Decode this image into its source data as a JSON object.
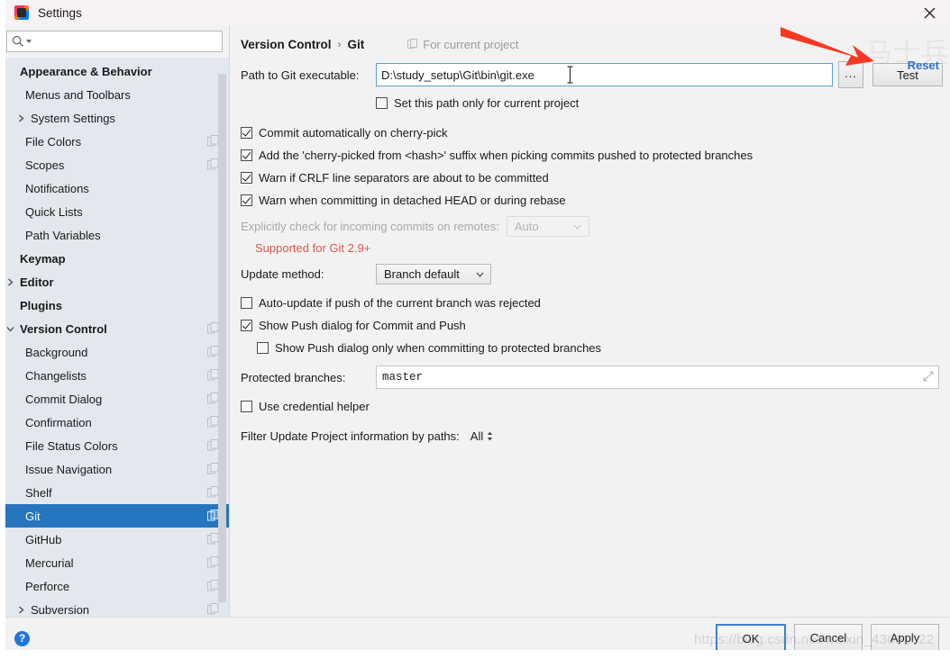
{
  "window": {
    "title": "Settings",
    "app_icon": "intellij-idea-icon",
    "close_label": "×"
  },
  "search": {
    "value": "",
    "placeholder": "",
    "icon": "search-icon"
  },
  "sidebar": {
    "items": [
      {
        "label": "Appearance & Behavior",
        "level": 0,
        "bold": true,
        "arrow": "none",
        "badge": false,
        "selected": false
      },
      {
        "label": "Menus and Toolbars",
        "level": 1,
        "bold": false,
        "arrow": "none",
        "badge": false,
        "selected": false
      },
      {
        "label": "System Settings",
        "level": 1,
        "bold": false,
        "arrow": "right",
        "badge": false,
        "selected": false
      },
      {
        "label": "File Colors",
        "level": 1,
        "bold": false,
        "arrow": "none",
        "badge": true,
        "selected": false
      },
      {
        "label": "Scopes",
        "level": 1,
        "bold": false,
        "arrow": "none",
        "badge": true,
        "selected": false
      },
      {
        "label": "Notifications",
        "level": 1,
        "bold": false,
        "arrow": "none",
        "badge": false,
        "selected": false
      },
      {
        "label": "Quick Lists",
        "level": 1,
        "bold": false,
        "arrow": "none",
        "badge": false,
        "selected": false
      },
      {
        "label": "Path Variables",
        "level": 1,
        "bold": false,
        "arrow": "none",
        "badge": false,
        "selected": false
      },
      {
        "label": "Keymap",
        "level": 0,
        "bold": true,
        "arrow": "none",
        "badge": false,
        "selected": false
      },
      {
        "label": "Editor",
        "level": 0,
        "bold": true,
        "arrow": "right",
        "badge": false,
        "selected": false
      },
      {
        "label": "Plugins",
        "level": 0,
        "bold": true,
        "arrow": "none",
        "badge": false,
        "selected": false
      },
      {
        "label": "Version Control",
        "level": 0,
        "bold": true,
        "arrow": "down",
        "badge": true,
        "selected": false
      },
      {
        "label": "Background",
        "level": 1,
        "bold": false,
        "arrow": "none",
        "badge": true,
        "selected": false
      },
      {
        "label": "Changelists",
        "level": 1,
        "bold": false,
        "arrow": "none",
        "badge": true,
        "selected": false
      },
      {
        "label": "Commit Dialog",
        "level": 1,
        "bold": false,
        "arrow": "none",
        "badge": true,
        "selected": false
      },
      {
        "label": "Confirmation",
        "level": 1,
        "bold": false,
        "arrow": "none",
        "badge": true,
        "selected": false
      },
      {
        "label": "File Status Colors",
        "level": 1,
        "bold": false,
        "arrow": "none",
        "badge": true,
        "selected": false
      },
      {
        "label": "Issue Navigation",
        "level": 1,
        "bold": false,
        "arrow": "none",
        "badge": true,
        "selected": false
      },
      {
        "label": "Shelf",
        "level": 1,
        "bold": false,
        "arrow": "none",
        "badge": true,
        "selected": false
      },
      {
        "label": "Git",
        "level": 1,
        "bold": false,
        "arrow": "none",
        "badge": true,
        "selected": true
      },
      {
        "label": "GitHub",
        "level": 1,
        "bold": false,
        "arrow": "none",
        "badge": true,
        "selected": false
      },
      {
        "label": "Mercurial",
        "level": 1,
        "bold": false,
        "arrow": "none",
        "badge": true,
        "selected": false
      },
      {
        "label": "Perforce",
        "level": 1,
        "bold": false,
        "arrow": "none",
        "badge": true,
        "selected": false
      },
      {
        "label": "Subversion",
        "level": 1,
        "bold": false,
        "arrow": "right",
        "badge": true,
        "selected": false
      }
    ]
  },
  "main": {
    "breadcrumb": {
      "parent": "Version Control",
      "separator": "›",
      "current": "Git"
    },
    "for_current_project": "For current project",
    "reset_link": "Reset",
    "path_label": "Path to Git executable:",
    "path_value": "D:\\study_setup\\Git\\bin\\git.exe",
    "browse_label": "...",
    "test_label": "Test",
    "set_path_only_label": "Set this path only for current project",
    "set_path_only_checked": false,
    "checkboxes": [
      {
        "label": "Commit automatically on cherry-pick",
        "checked": true
      },
      {
        "label": "Add the 'cherry-picked from <hash>' suffix when picking commits pushed to protected branches",
        "checked": true
      },
      {
        "label": "Warn if CRLF line separators are about to be committed",
        "checked": true
      },
      {
        "label": "Warn when committing in detached HEAD or during rebase",
        "checked": true
      }
    ],
    "explicit_check_label": "Explicitly check for incoming commits on remotes:",
    "explicit_check_value": "Auto",
    "explicit_check_disabled": true,
    "supported_note": "Supported for Git 2.9+",
    "update_method_label": "Update method:",
    "update_method_value": "Branch default",
    "auto_update_label": "Auto-update if push of the current branch was rejected",
    "auto_update_checked": false,
    "show_push_label": "Show Push dialog for Commit and Push",
    "show_push_checked": true,
    "show_push_protected_label": "Show Push dialog only when committing to protected branches",
    "show_push_protected_checked": false,
    "protected_branches_label": "Protected branches:",
    "protected_branches_value": "master",
    "credential_helper_label": "Use credential helper",
    "credential_helper_checked": false,
    "filter_label": "Filter Update Project information by paths:",
    "filter_value": "All"
  },
  "footer": {
    "help_label": "?",
    "ok_label": "OK",
    "cancel_label": "Cancel",
    "apply_label": "Apply"
  },
  "watermarks": {
    "url": "https://blog.csdn.net/weixin_43691622",
    "cn": "马士兵"
  },
  "annotation": {
    "arrow_color": "#f93822"
  },
  "colors": {
    "selection": "#2675bf",
    "link": "#2e6fd4",
    "note_red": "#e0564b",
    "sidebar_bg": "#e3e8ef",
    "panel_bg": "#f2f2f2"
  }
}
